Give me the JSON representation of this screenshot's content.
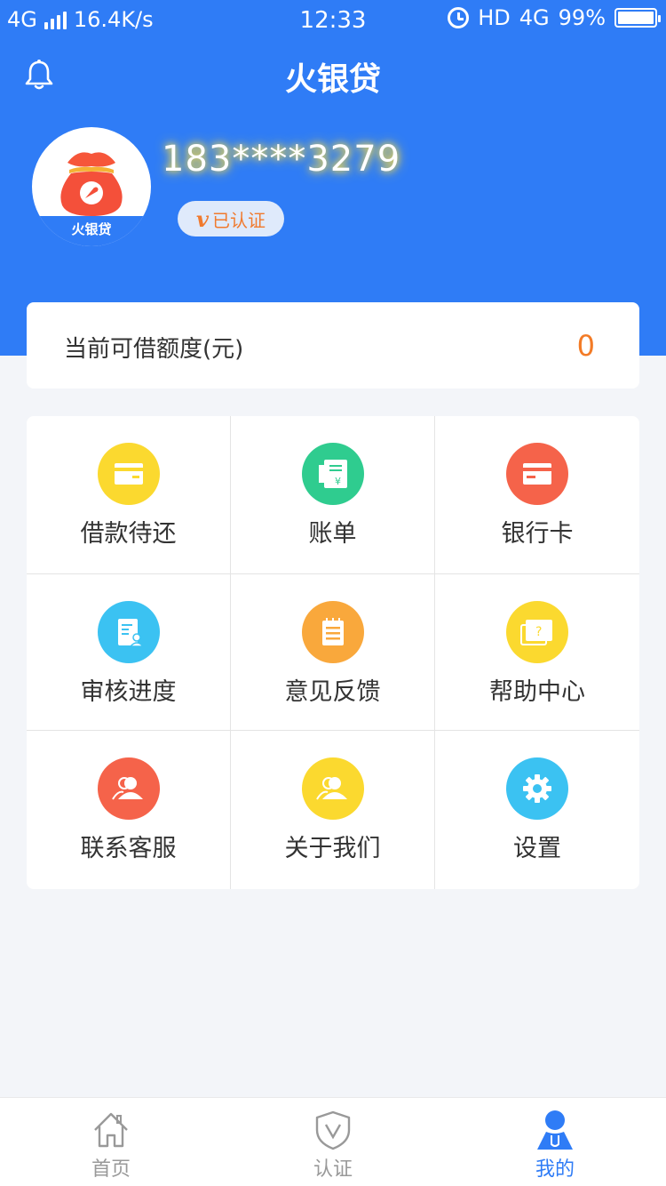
{
  "status_bar": {
    "network": "4G",
    "speed": "16.4K/s",
    "time": "12:33",
    "hd": "HD",
    "network_right": "4G",
    "battery": "99%",
    "battery_level": 0.99
  },
  "header": {
    "title": "火银贷"
  },
  "profile": {
    "avatar_label": "火银贷",
    "phone": "183****3279",
    "verified_mark": "v",
    "verified_text": "已认证"
  },
  "credit": {
    "label": "当前可借额度(元)",
    "value": "0"
  },
  "menu": [
    {
      "label": "借款待还",
      "icon": "wallet-icon",
      "color": "#fbd92f"
    },
    {
      "label": "账单",
      "icon": "bill-icon",
      "color": "#2fcc8f"
    },
    {
      "label": "银行卡",
      "icon": "bank-card-icon",
      "color": "#f5634a"
    },
    {
      "label": "审核进度",
      "icon": "review-progress-icon",
      "color": "#3bc2f2"
    },
    {
      "label": "意见反馈",
      "icon": "feedback-icon",
      "color": "#f9a83c"
    },
    {
      "label": "帮助中心",
      "icon": "help-center-icon",
      "color": "#fbd92f"
    },
    {
      "label": "联系客服",
      "icon": "customer-service-icon",
      "color": "#f5634a"
    },
    {
      "label": "关于我们",
      "icon": "about-us-icon",
      "color": "#fbd92f"
    },
    {
      "label": "设置",
      "icon": "settings-icon",
      "color": "#3bc2f2"
    }
  ],
  "tabs": [
    {
      "label": "首页",
      "icon": "home-icon",
      "active": false
    },
    {
      "label": "认证",
      "icon": "shield-v-icon",
      "active": false
    },
    {
      "label": "我的",
      "icon": "profile-icon",
      "active": true
    }
  ],
  "colors": {
    "primary": "#2f7cf6",
    "accent_orange": "#f37b26",
    "background": "#f3f5f9"
  }
}
